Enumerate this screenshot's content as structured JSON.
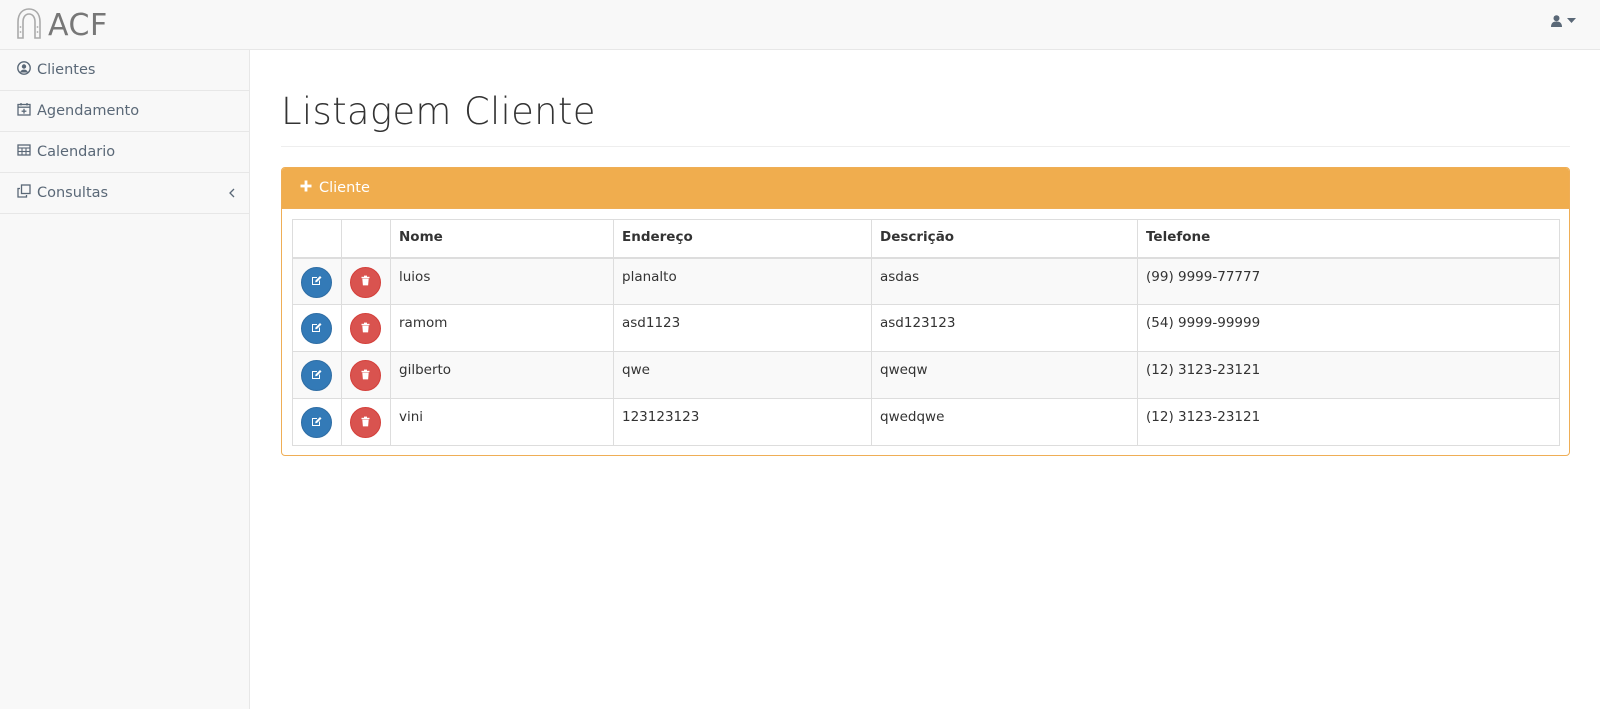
{
  "app": {
    "brand": "ACF"
  },
  "sidebar": {
    "items": [
      {
        "label": "Clientes",
        "icon": "user-circle-icon"
      },
      {
        "label": "Agendamento",
        "icon": "calendar-plus-icon"
      },
      {
        "label": "Calendario",
        "icon": "table-icon"
      },
      {
        "label": "Consultas",
        "icon": "clone-icon",
        "has_submenu": true
      }
    ]
  },
  "main": {
    "title": "Listagem Cliente",
    "panel": {
      "add_label": "Cliente",
      "accent_color": "#f0ad4e"
    },
    "table": {
      "headers": [
        "Nome",
        "Endereço",
        "Descrição",
        "Telefone"
      ],
      "rows": [
        {
          "nome": "luios",
          "endereco": "planalto",
          "descricao": "asdas",
          "telefone": "(99) 9999-77777"
        },
        {
          "nome": "ramom",
          "endereco": "asd1123",
          "descricao": "asd123123",
          "telefone": "(54) 9999-99999"
        },
        {
          "nome": "gilberto",
          "endereco": "qwe",
          "descricao": "qweqw",
          "telefone": "(12) 3123-23121"
        },
        {
          "nome": "vini",
          "endereco": "123123123",
          "descricao": "qwedqwe",
          "telefone": "(12) 3123-23121"
        }
      ]
    }
  },
  "colors": {
    "edit_button": "#337ab7",
    "delete_button": "#d9534f",
    "navbar_bg": "#f8f8f8"
  }
}
